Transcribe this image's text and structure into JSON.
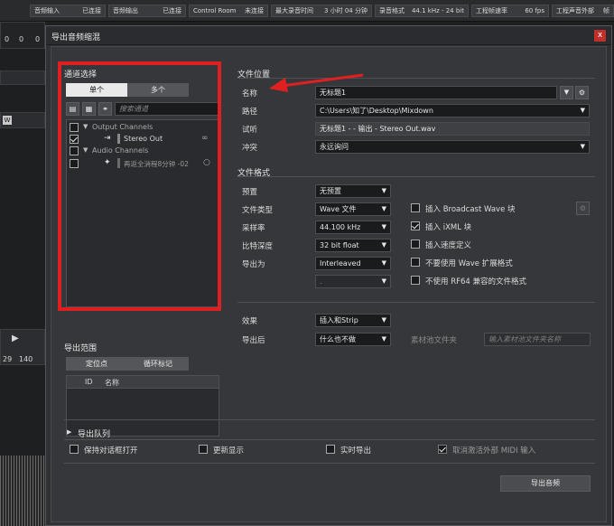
{
  "statusbar": {
    "items": [
      {
        "label": "音频输入",
        "value": "已连接"
      },
      {
        "label": "音频输出",
        "value": "已连接"
      },
      {
        "label": "Control Room",
        "value": "未连接"
      },
      {
        "label": "最大录音时间",
        "value": "3 小时 04 分钟"
      },
      {
        "label": "录音格式",
        "value": "44.1 kHz - 24 bit"
      },
      {
        "label": "工程帧速率",
        "value": "60 fps"
      },
      {
        "label": "工程声音外部",
        "value": "帧"
      }
    ]
  },
  "background": {
    "ruler_left": "0",
    "ruler_num1": "0",
    "ruler_num2": "0",
    "w_btn": "W",
    "marker_start": "29",
    "marker_end": "140"
  },
  "dialog": {
    "title": "导出音频缩混",
    "close_label": "x",
    "channel_select": {
      "heading": "通道选择",
      "tab_single": "单个",
      "tab_multi": "多个",
      "search_placeholder": "搜索通道",
      "tree": [
        {
          "label": "Output Channels",
          "kind": "group",
          "checked": false
        },
        {
          "label": "Stereo Out",
          "kind": "item",
          "checked": true
        },
        {
          "label": "Audio Channels",
          "kind": "group",
          "checked": false
        },
        {
          "label": "再返全消程8分钟 -02",
          "kind": "item",
          "checked": false
        }
      ]
    },
    "export_range": {
      "heading": "导出范围",
      "tab_locators": "定位点",
      "tab_cycle": "循环标记",
      "col_id": "ID",
      "col_name": "名称"
    },
    "file_location": {
      "heading": "文件位置",
      "name_label": "名称",
      "name_value": "无标题1",
      "path_label": "路径",
      "path_value": "C:\\Users\\知了\\Desktop\\Mixdown",
      "preview_label": "试听",
      "preview_value": "无标题1 - - 输出 - Stereo Out.wav",
      "conflict_label": "冲突",
      "conflict_value": "永远询问"
    },
    "file_format": {
      "heading": "文件格式",
      "preset_label": "预置",
      "preset_value": "无预置",
      "type_label": "文件类型",
      "type_value": "Wave 文件",
      "samplerate_label": "采样率",
      "samplerate_value": "44.100 kHz",
      "bitdepth_label": "比特深度",
      "bitdepth_value": "32 bit float",
      "exportas_label": "导出为",
      "exportas_value": "Interleaved",
      "extra_value": ".",
      "bwf_label": "插入 Broadcast Wave 块",
      "bwf_checked": false,
      "ixml_label": "插入 iXML 块",
      "ixml_checked": true,
      "tempo_label": "插入速度定义",
      "tempo_checked": false,
      "noext_label": "不要使用 Wave 扩展格式",
      "noext_checked": false,
      "rf64_label": "不使用 RF64 兼容的文件格式",
      "rf64_checked": false
    },
    "post": {
      "effects_label": "效果",
      "effects_value": "插入和Strip",
      "after_label": "导出后",
      "after_value": "什么也不做",
      "pool_label": "素材池文件夹",
      "pool_placeholder": "输入素材池文件夹名称"
    },
    "queue": {
      "heading": "导出队列"
    },
    "footer": {
      "keep_open": "保持对话框打开",
      "update_display": "更新显示",
      "realtime": "实时导出",
      "deactivate_midi": "取消激活外部 MIDI 输入",
      "deactivate_midi_checked": true,
      "export_button": "导出音频"
    }
  }
}
